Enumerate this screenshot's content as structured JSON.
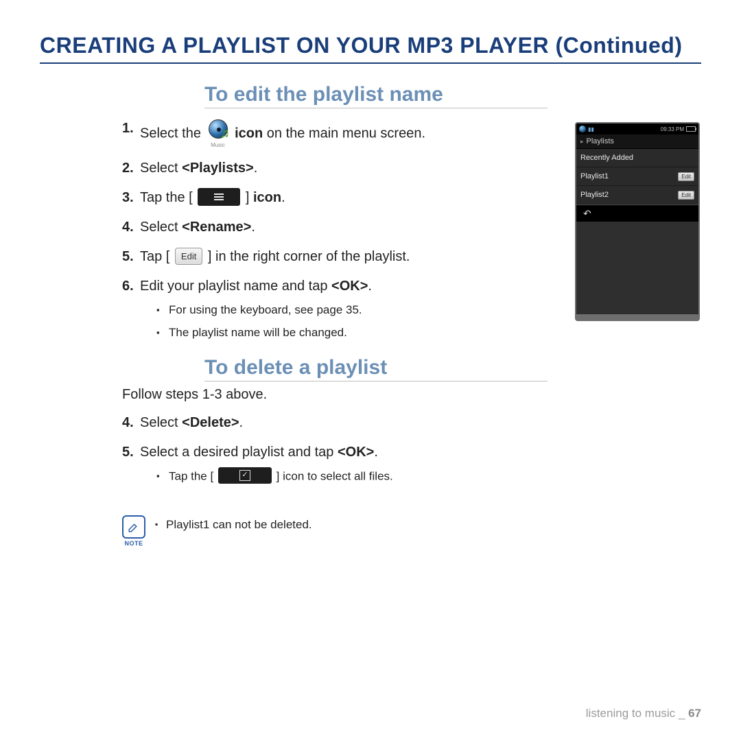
{
  "title": "CREATING A PLAYLIST ON YOUR MP3 PLAYER (Continued)",
  "sections": {
    "edit": {
      "heading": "To edit the playlist name",
      "step1_a": "Select the ",
      "step1_b": " icon",
      "step1_c": " on the main menu screen.",
      "music_label": "Music",
      "step2_a": "Select ",
      "step2_b": "<Playlists>",
      "step2_c": ".",
      "step3_a": "Tap the [ ",
      "step3_b": " ] ",
      "step3_c": "icon",
      "step3_d": ".",
      "step4_a": "Select ",
      "step4_b": "<Rename>",
      "step4_c": ".",
      "step5_a": "Tap [ ",
      "step5_edit": "Edit",
      "step5_b": " ] in the right corner of the playlist.",
      "step6_a": "Edit your playlist name and tap ",
      "step6_b": "<OK>",
      "step6_c": ".",
      "sub1": "For using the keyboard, see page 35.",
      "sub2": "The playlist name will be changed."
    },
    "delete": {
      "heading": "To delete a playlist",
      "follow": "Follow steps 1-3 above.",
      "step4_a": "Select ",
      "step4_b": "<Delete>",
      "step4_c": ".",
      "step5_a": "Select a desired playlist and tap ",
      "step5_b": "<OK>",
      "step5_c": ".",
      "sub1_a": "Tap the [ ",
      "sub1_b": " ] icon to select all files."
    },
    "note": {
      "label": "NOTE",
      "text": "Playlist1 can not be deleted."
    }
  },
  "device": {
    "time": "09:33 PM",
    "header": "Playlists",
    "rows": [
      {
        "name": "Recently Added",
        "edit": null
      },
      {
        "name": "Playlist1",
        "edit": "Edit"
      },
      {
        "name": "Playlist2",
        "edit": "Edit"
      }
    ],
    "back": "↰"
  },
  "footer": {
    "section": "listening to music",
    "sep": " _ ",
    "page": "67"
  }
}
